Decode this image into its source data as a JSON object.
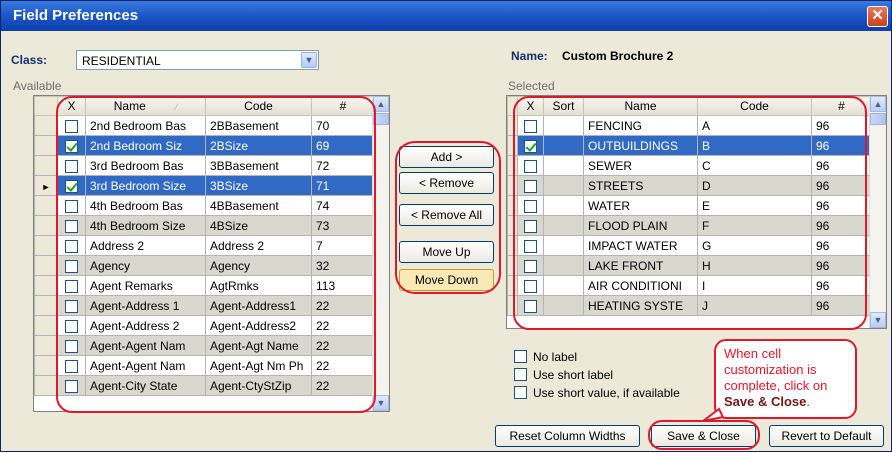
{
  "window": {
    "title": "Field Preferences",
    "close_glyph": "✕"
  },
  "class_field": {
    "label": "Class:",
    "value": "RESIDENTIAL"
  },
  "name_field": {
    "label": "Name:",
    "value": "Custom Brochure 2"
  },
  "available": {
    "heading": "Available",
    "columns": {
      "check": "X",
      "name": "Name",
      "code": "Code",
      "num": "#"
    },
    "rows": [
      {
        "checked": false,
        "name": "2nd Bedroom Bas",
        "code": "2BBasement",
        "num": "70"
      },
      {
        "checked": true,
        "name": "2nd Bedroom Siz",
        "code": "2BSize",
        "num": "69"
      },
      {
        "checked": false,
        "name": "3rd Bedroom Bas",
        "code": "3BBasement",
        "num": "72"
      },
      {
        "checked": true,
        "name": "3rd Bedroom Size",
        "code": "3BSize",
        "num": "71"
      },
      {
        "checked": false,
        "name": "4th Bedroom Bas",
        "code": "4BBasement",
        "num": "74"
      },
      {
        "checked": false,
        "name": "4th Bedroom Size",
        "code": "4BSize",
        "num": "73"
      },
      {
        "checked": false,
        "name": "Address 2",
        "code": "Address 2",
        "num": "7"
      },
      {
        "checked": false,
        "name": "Agency",
        "code": "Agency",
        "num": "32"
      },
      {
        "checked": false,
        "name": "Agent Remarks",
        "code": "AgtRmks",
        "num": "113"
      },
      {
        "checked": false,
        "name": "Agent-Address 1",
        "code": "Agent-Address1",
        "num": "22"
      },
      {
        "checked": false,
        "name": "Agent-Address 2",
        "code": "Agent-Address2",
        "num": "22"
      },
      {
        "checked": false,
        "name": "Agent-Agent Nam",
        "code": "Agent-Agt Name",
        "num": "22"
      },
      {
        "checked": false,
        "name": "Agent-Agent Nam",
        "code": "Agent-Agt Nm Ph",
        "num": "22"
      },
      {
        "checked": false,
        "name": "Agent-City State",
        "code": "Agent-CtyStZip",
        "num": "22"
      }
    ]
  },
  "buttons": {
    "add": "Add >",
    "remove": "< Remove",
    "remove_all": "< Remove All",
    "move_up": "Move Up",
    "move_down": "Move Down",
    "reset_widths": "Reset Column Widths",
    "save_close": "Save & Close",
    "revert": "Revert to Default"
  },
  "selected": {
    "heading": "Selected",
    "columns": {
      "check": "X",
      "sort": "Sort",
      "name": "Name",
      "code": "Code",
      "num": "#"
    },
    "rows": [
      {
        "checked": false,
        "sort": "",
        "name": "FENCING",
        "code": "A",
        "num": "96"
      },
      {
        "checked": true,
        "sort": "",
        "name": "OUTBUILDINGS",
        "code": "B",
        "num": "96"
      },
      {
        "checked": false,
        "sort": "",
        "name": "SEWER",
        "code": "C",
        "num": "96"
      },
      {
        "checked": false,
        "sort": "",
        "name": "STREETS",
        "code": "D",
        "num": "96"
      },
      {
        "checked": false,
        "sort": "",
        "name": "WATER",
        "code": "E",
        "num": "96"
      },
      {
        "checked": false,
        "sort": "",
        "name": "FLOOD PLAIN",
        "code": "F",
        "num": "96"
      },
      {
        "checked": false,
        "sort": "",
        "name": "IMPACT WATER",
        "code": "G",
        "num": "96"
      },
      {
        "checked": false,
        "sort": "",
        "name": "LAKE FRONT",
        "code": "H",
        "num": "96"
      },
      {
        "checked": false,
        "sort": "",
        "name": "AIR CONDITIONI",
        "code": "I",
        "num": "96"
      },
      {
        "checked": false,
        "sort": "",
        "name": "HEATING SYSTE",
        "code": "J",
        "num": "96"
      }
    ]
  },
  "label_options": {
    "no_label": "No label",
    "short_label": "Use short label",
    "short_value": "Use short value, if available"
  },
  "callout": {
    "line1": "When cell customization is complete, click on",
    "strong": "Save & Close",
    "end": "."
  },
  "colors": {
    "selection": "#316ac5",
    "annotation": "#e0182b",
    "titlebar": "#1d5ac8"
  }
}
